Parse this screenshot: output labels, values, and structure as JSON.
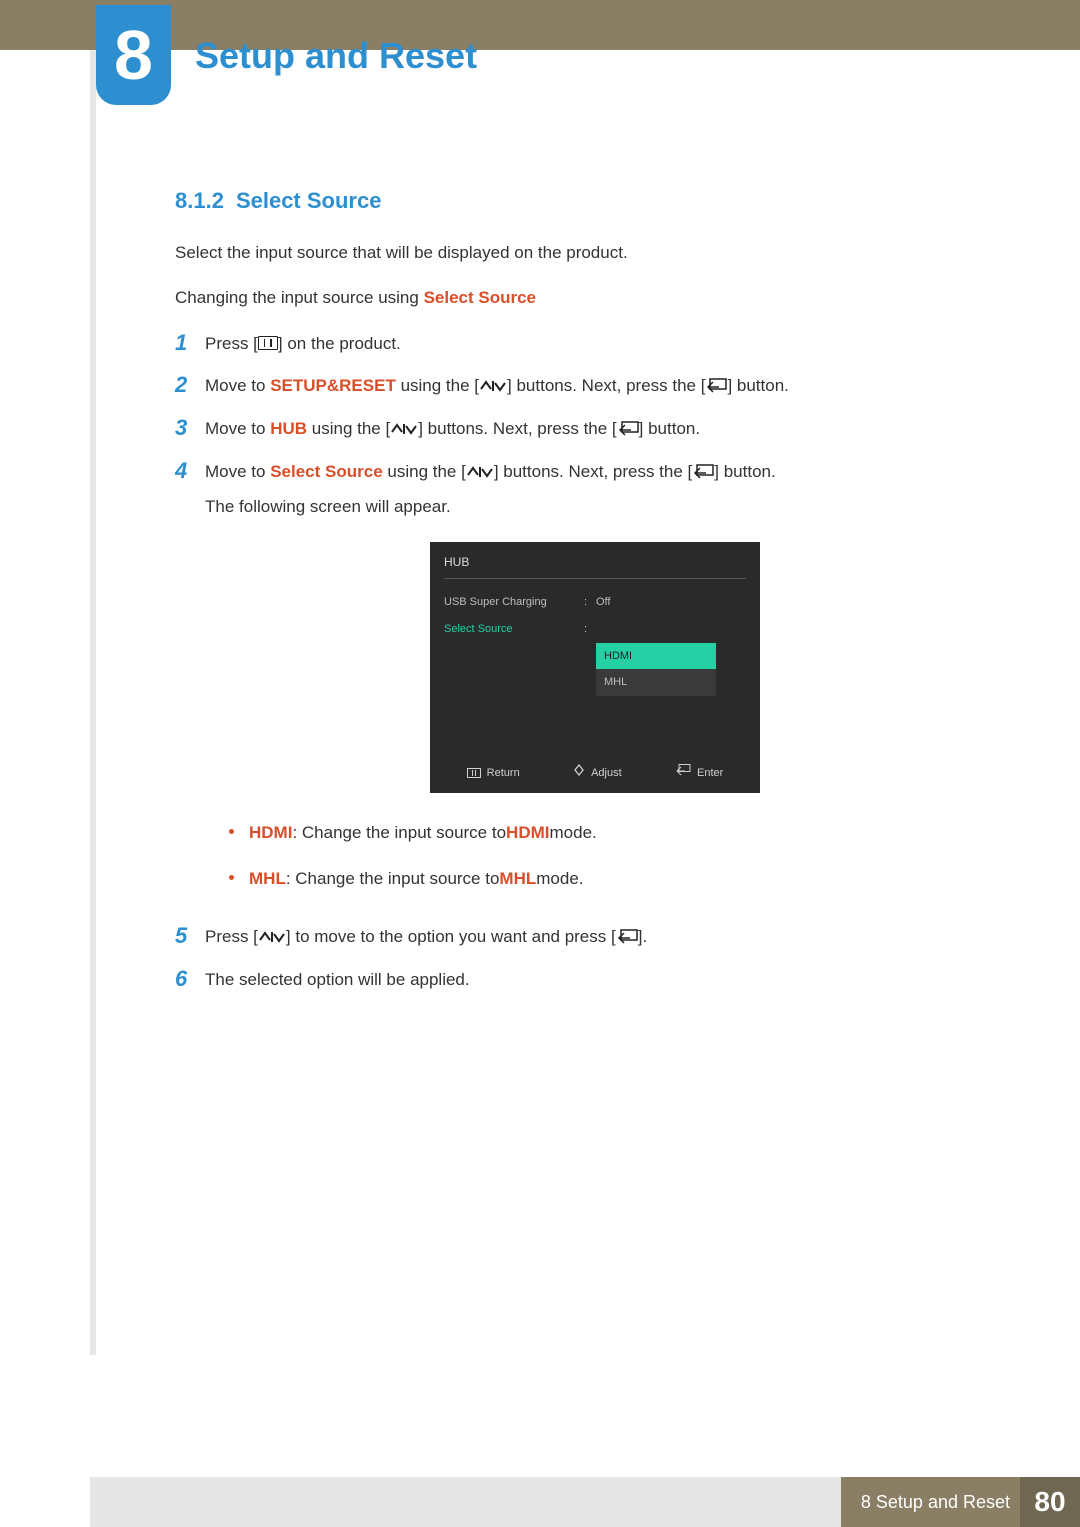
{
  "chapter": {
    "number": "8",
    "title": "Setup and Reset"
  },
  "section": {
    "number": "8.1.2",
    "title": "Select Source"
  },
  "intro": "Select the input source that will be displayed on the product.",
  "subhead_prefix": "Changing the input source using ",
  "subhead_em": "Select Source",
  "steps": {
    "s1": {
      "num": "1",
      "a": "Press [",
      "b": "] on the product."
    },
    "s2": {
      "num": "2",
      "a": "Move to ",
      "em1": "SETUP&RESET",
      "b": " using the [",
      "c": "] buttons. Next, press the [",
      "d": "] button."
    },
    "s3": {
      "num": "3",
      "a": "Move to ",
      "em1": "HUB",
      "b": " using the [",
      "c": "] buttons. Next, press the [",
      "d": "] button."
    },
    "s4": {
      "num": "4",
      "a": "Move to ",
      "em1": "Select Source",
      "b": " using the [",
      "c": "] buttons. Next, press the [",
      "d": "] button.",
      "line2": "The following screen will appear."
    },
    "s5": {
      "num": "5",
      "a": "Press [",
      "b": "] to move to the option you want and press [",
      "c": "]."
    },
    "s6": {
      "num": "6",
      "a": "The selected option will be applied."
    }
  },
  "osd": {
    "title": "HUB",
    "row1": {
      "label": "USB Super Charging",
      "value": "Off"
    },
    "row2": {
      "label": "Select Source"
    },
    "options": {
      "opt1": "HDMI",
      "opt2": "MHL"
    },
    "footer": {
      "return": "Return",
      "adjust": "Adjust",
      "enter": "Enter"
    }
  },
  "bullets": {
    "b1": {
      "em": "HDMI",
      "a": ": Change the input source to ",
      "em2": "HDMI",
      "b": " mode."
    },
    "b2": {
      "em": "MHL",
      "a": ": Change the input source to ",
      "em2": "MHL",
      "b": " mode."
    }
  },
  "footer": {
    "label": "8 Setup and Reset",
    "page": "80"
  }
}
